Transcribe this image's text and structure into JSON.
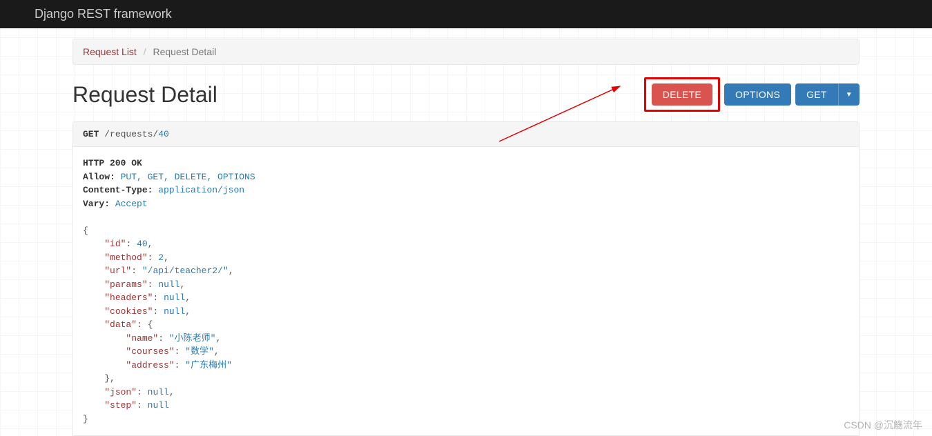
{
  "navbar": {
    "brand": "Django REST framework"
  },
  "breadcrumb": {
    "root": "Request List",
    "current": "Request Detail"
  },
  "page": {
    "title": "Request Detail"
  },
  "buttons": {
    "delete": "DELETE",
    "options": "OPTIONS",
    "get": "GET"
  },
  "request": {
    "method": "GET",
    "path": "/requests/",
    "id": "40"
  },
  "response": {
    "status_line": "HTTP 200 OK",
    "headers": {
      "allow_label": "Allow:",
      "allow_value": "PUT, GET, DELETE, OPTIONS",
      "content_type_label": "Content-Type:",
      "content_type_value": "application/json",
      "vary_label": "Vary:",
      "vary_value": "Accept"
    },
    "body": {
      "id_key": "\"id\"",
      "id_val": "40",
      "method_key": "\"method\"",
      "method_val": "2",
      "url_key": "\"url\"",
      "url_val": "\"/api/teacher2/\"",
      "params_key": "\"params\"",
      "params_val": "null",
      "headers_key": "\"headers\"",
      "headers_val": "null",
      "cookies_key": "\"cookies\"",
      "cookies_val": "null",
      "data_key": "\"data\"",
      "data_open": "{",
      "name_key": "\"name\"",
      "name_val": "\"小陈老师\"",
      "courses_key": "\"courses\"",
      "courses_val": "\"数学\"",
      "address_key": "\"address\"",
      "address_val": "\"广东梅州\"",
      "json_key": "\"json\"",
      "json_val": "null",
      "step_key": "\"step\"",
      "step_val": "null"
    }
  },
  "watermark": "CSDN @沉觞流年"
}
